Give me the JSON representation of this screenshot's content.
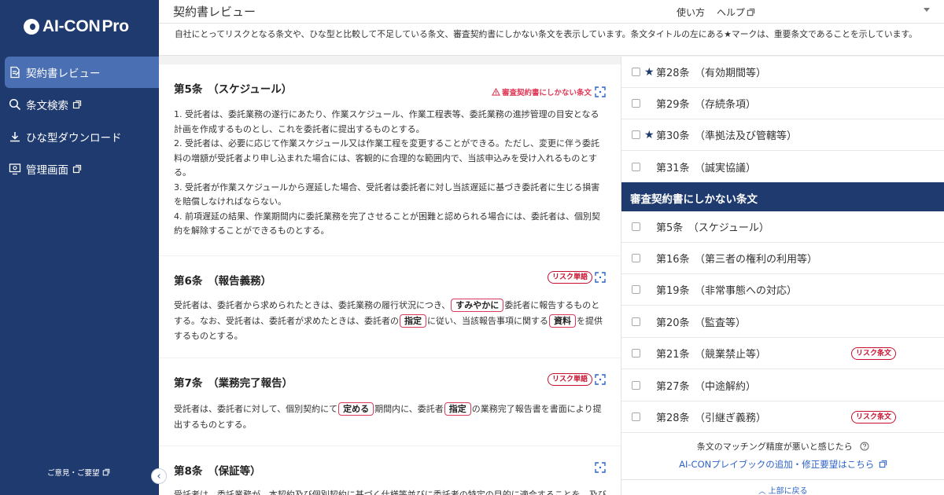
{
  "app": {
    "logo_text": "AI-CON",
    "logo_suffix": "Pro"
  },
  "sidebar": {
    "items": [
      {
        "label": "契約書レビュー",
        "icon": "document-review-icon",
        "active": true
      },
      {
        "label": "条文検索",
        "icon": "search-icon",
        "external": true
      },
      {
        "label": "ひな型ダウンロード",
        "icon": "download-icon"
      },
      {
        "label": "管理画面",
        "icon": "admin-settings-icon",
        "external": true
      }
    ],
    "feedback_label": "ご意見・ご要望"
  },
  "header": {
    "title": "契約書レビュー",
    "usage_label": "使い方",
    "help_label": "ヘルプ"
  },
  "description": "自社にとってリスクとなる条文や、ひな型と比較して不足している条文、審査契約書にしかない条文を表示しています。条文タイトルの左にある★マークは、重要条文であることを示しています。",
  "clauses": [
    {
      "title": "第5条　（スケジュール）",
      "badge": "審査契約書にしかない条文",
      "paragraphs": [
        "1. 受託者は、委託業務の遂行にあたり、作業スケジュール、作業工程表等、委託業務の進捗管理の目安となる計画を作成するものとし、これを委託者に提出するものとする。",
        "2. 受託者は、必要に応じて作業スケジュール又は作業工程を変更することができる。ただし、変更に伴う委託料の増額が受託者より申し込まれた場合には、客観的に合理的な範囲内で、当該申込みを受け入れるものとする。",
        "3. 受託者が作業スケジュールから遅延した場合、受託者は委託者に対し当該遅延に基づき委託者に生じる損害を賠償しなければならない。",
        "4. 前項遅延の結果、作業期間内に委託業務を完了させることが困難と認められる場合には、委託者は、個別契約を解除することができるものとする。"
      ]
    },
    {
      "title": "第6条　（報告義務）",
      "badge": "リスク単語",
      "segments": [
        "受託者は、委託者から求められたときは、委託業務の履行状況につき、",
        "すみやかに",
        "委託者に報告するものとする。なお、受託者は、委託者が求めたときは、委託者の",
        "指定",
        "に従い、当該報告事項に関する",
        "資料",
        "を提供するものとする。"
      ]
    },
    {
      "title": "第7条　（業務完了報告）",
      "badge": "リスク単語",
      "segments": [
        "受託者は、委託者に対して、個別契約にて",
        "定める",
        "期間内に、委託者",
        "指定",
        "の業務完了報告書を書面により提出するものとする。"
      ]
    },
    {
      "title": "第8条　（保証等）",
      "partial_text": "受託者は、委託業務が、本契約及び個別契約に基づく仕様等並びに委託者の特定の目的に適合することを、及び"
    }
  ],
  "right_panel": {
    "items_top": [
      {
        "label": "第28条　（有効期間等）",
        "star": true
      },
      {
        "label": "第29条　（存続条項）",
        "star": false
      },
      {
        "label": "第30条　（準拠法及び管轄等）",
        "star": true
      },
      {
        "label": "第31条　（誠実協議）",
        "star": false
      }
    ],
    "section_title": "審査契約書にしかない条文",
    "items_bottom": [
      {
        "label": "第5条　（スケジュール）",
        "badge": ""
      },
      {
        "label": "第16条　（第三者の権利の利用等）",
        "badge": ""
      },
      {
        "label": "第19条　（非常事態への対応）",
        "badge": ""
      },
      {
        "label": "第20条　（監査等）",
        "badge": ""
      },
      {
        "label": "第21条　（競業禁止等）",
        "badge": "リスク条文"
      },
      {
        "label": "第27条　（中途解約）",
        "badge": ""
      },
      {
        "label": "第28条　（引継ぎ義務）",
        "badge": "リスク条文"
      }
    ],
    "match_question": "条文のマッチング精度が悪いと感じたら",
    "match_link": "AI-CONプレイブックの追加・修正要望はこちら",
    "back_to_top": "上部に戻る"
  },
  "colors": {
    "sidebar_bg": "#1f3a6e",
    "active_nav": "#4a6fb3",
    "risk_red": "#c8102e",
    "link_blue": "#2d63c8"
  }
}
